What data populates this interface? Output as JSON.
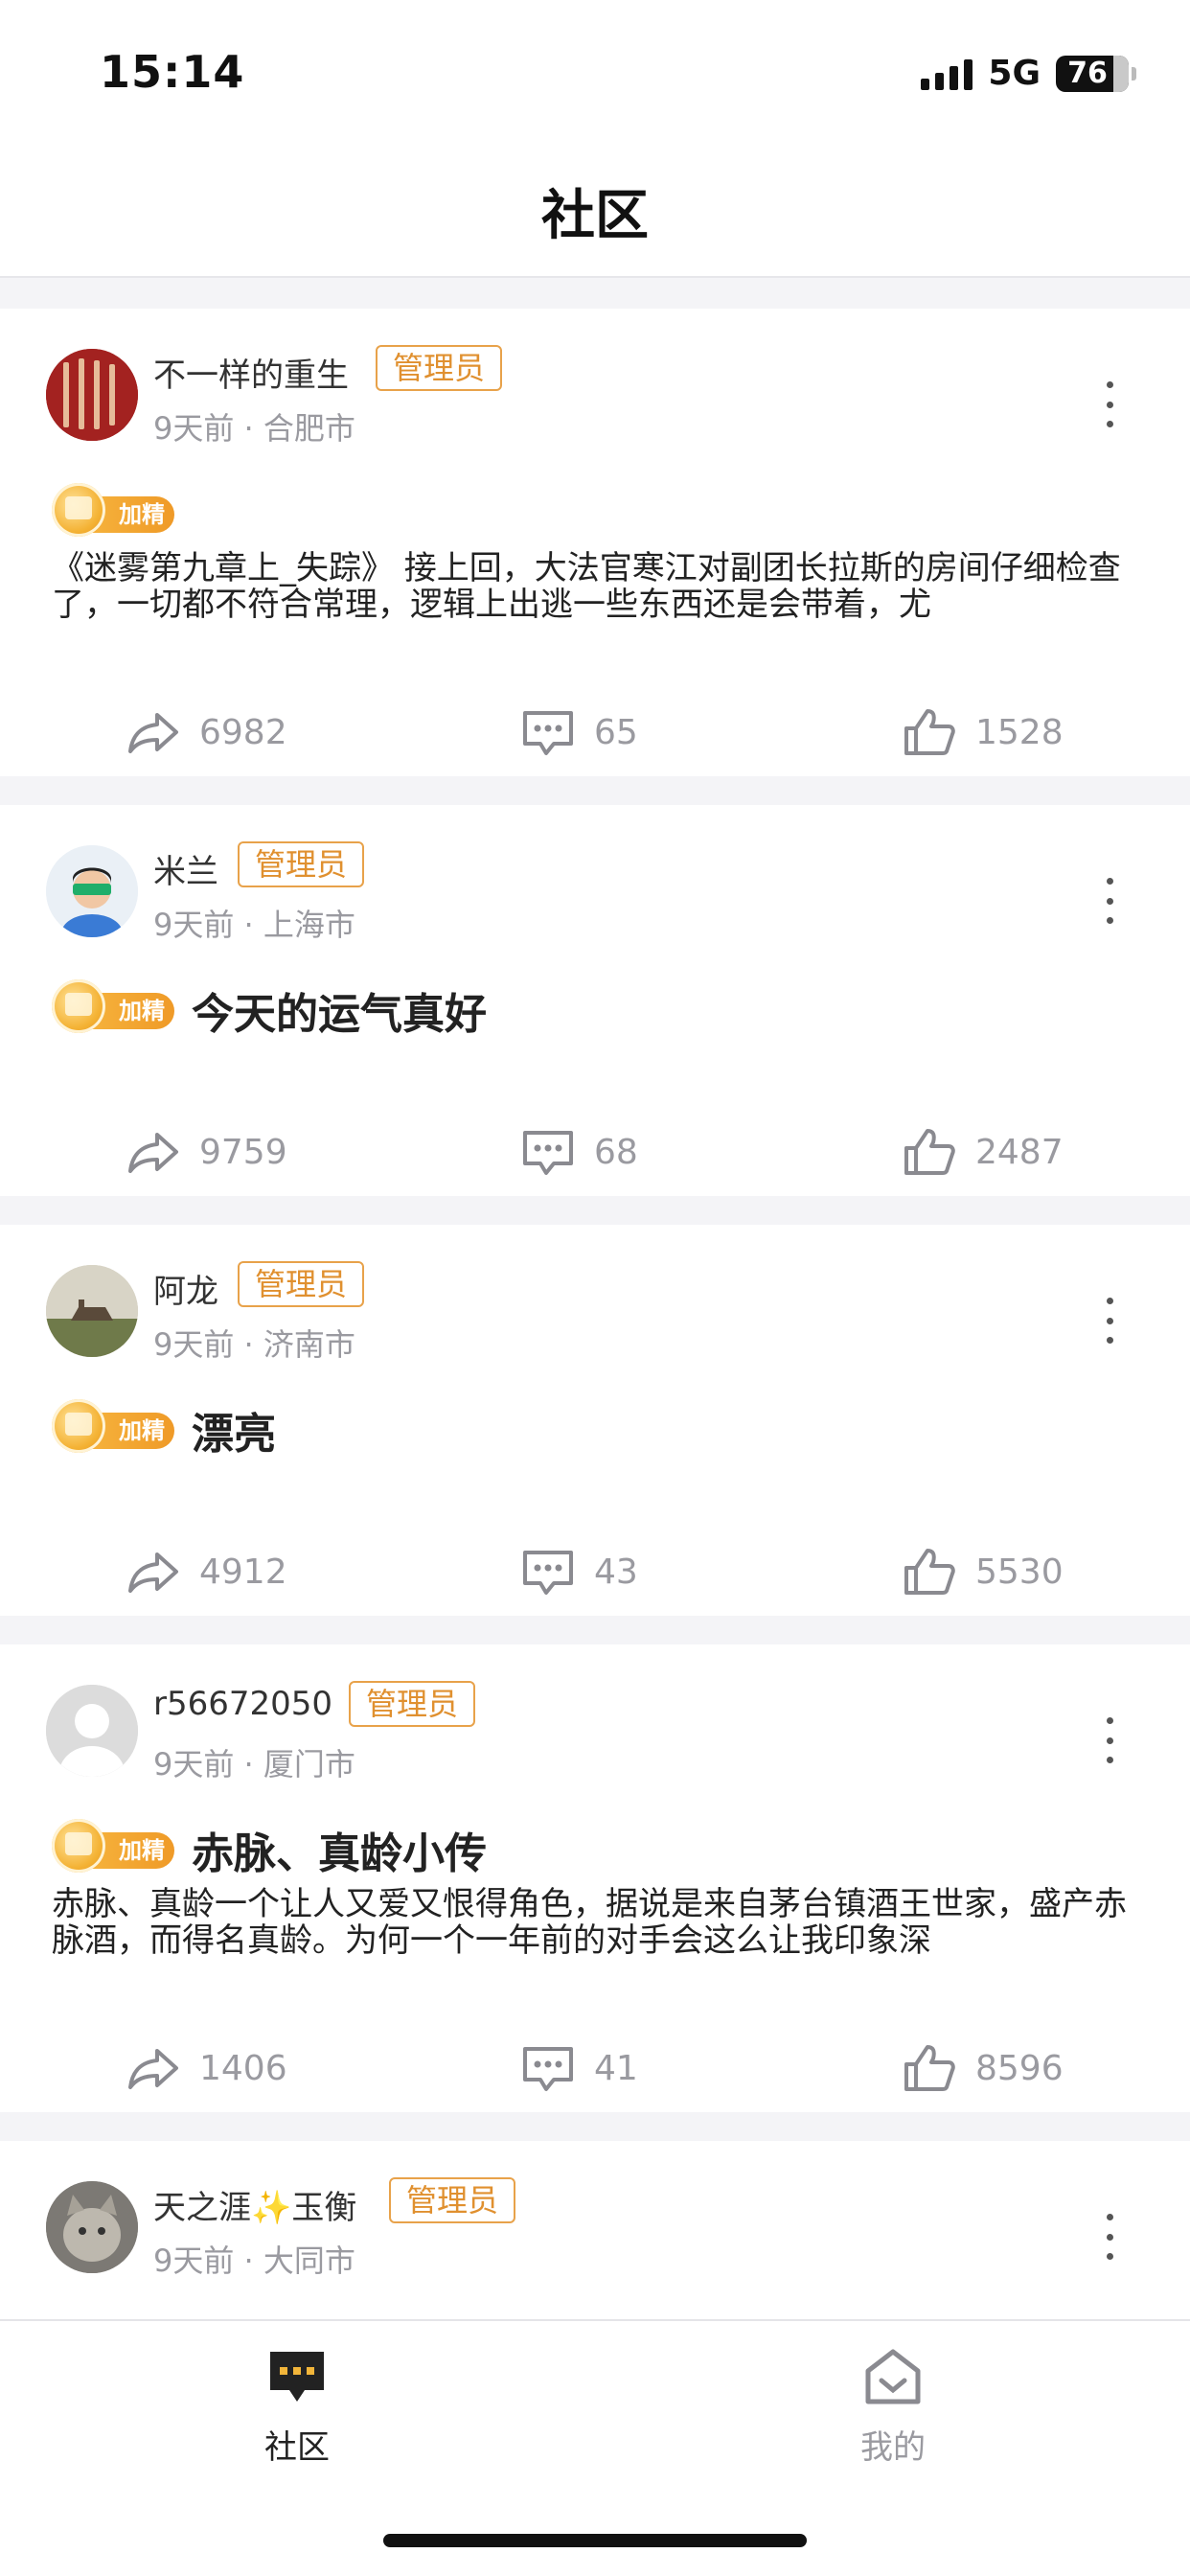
{
  "status": {
    "time": "15:14",
    "network": "5G",
    "battery": "76"
  },
  "nav": {
    "title": "社区"
  },
  "posts": [
    {
      "user": "不一样的重生",
      "badge": "管理员",
      "meta": "9天前 · 合肥市",
      "tag": "加精",
      "title": "",
      "body": "《迷雾第九章上_失踪》 接上回，大法官寒江对副团长拉斯的房间仔细检查了，一切都不符合常理，逻辑上出逃一些东西还是会带着，尤",
      "shares": "6982",
      "comments": "65",
      "likes": "1528"
    },
    {
      "user": "米兰",
      "badge": "管理员",
      "meta": "9天前 · 上海市",
      "tag": "加精",
      "title": "今天的运气真好",
      "body": "",
      "shares": "9759",
      "comments": "68",
      "likes": "2487"
    },
    {
      "user": "阿龙",
      "badge": "管理员",
      "meta": "9天前 · 济南市",
      "tag": "加精",
      "title": "漂亮",
      "body": "",
      "shares": "4912",
      "comments": "43",
      "likes": "5530"
    },
    {
      "user": "r56672050",
      "badge": "管理员",
      "meta": "9天前 · 厦门市",
      "tag": "加精",
      "title": "赤脉、真龄小传",
      "body": "赤脉、真龄一个让人又爱又恨得角色，据说是来自茅台镇酒王世家，盛产赤脉酒，而得名真龄。为何一个一年前的对手会这么让我印象深",
      "shares": "1406",
      "comments": "41",
      "likes": "8596"
    },
    {
      "user": "天之涯✨玉衡",
      "badge": "管理员",
      "meta": "9天前 · 大同市"
    }
  ],
  "tabs": [
    {
      "label": "社区",
      "icon": "community-icon",
      "active": true
    },
    {
      "label": "我的",
      "icon": "profile-home-icon",
      "active": false
    }
  ],
  "colors": {
    "accent": "#e0902f",
    "active_tab": "#222222",
    "inactive_tab": "#9a9aa0"
  }
}
